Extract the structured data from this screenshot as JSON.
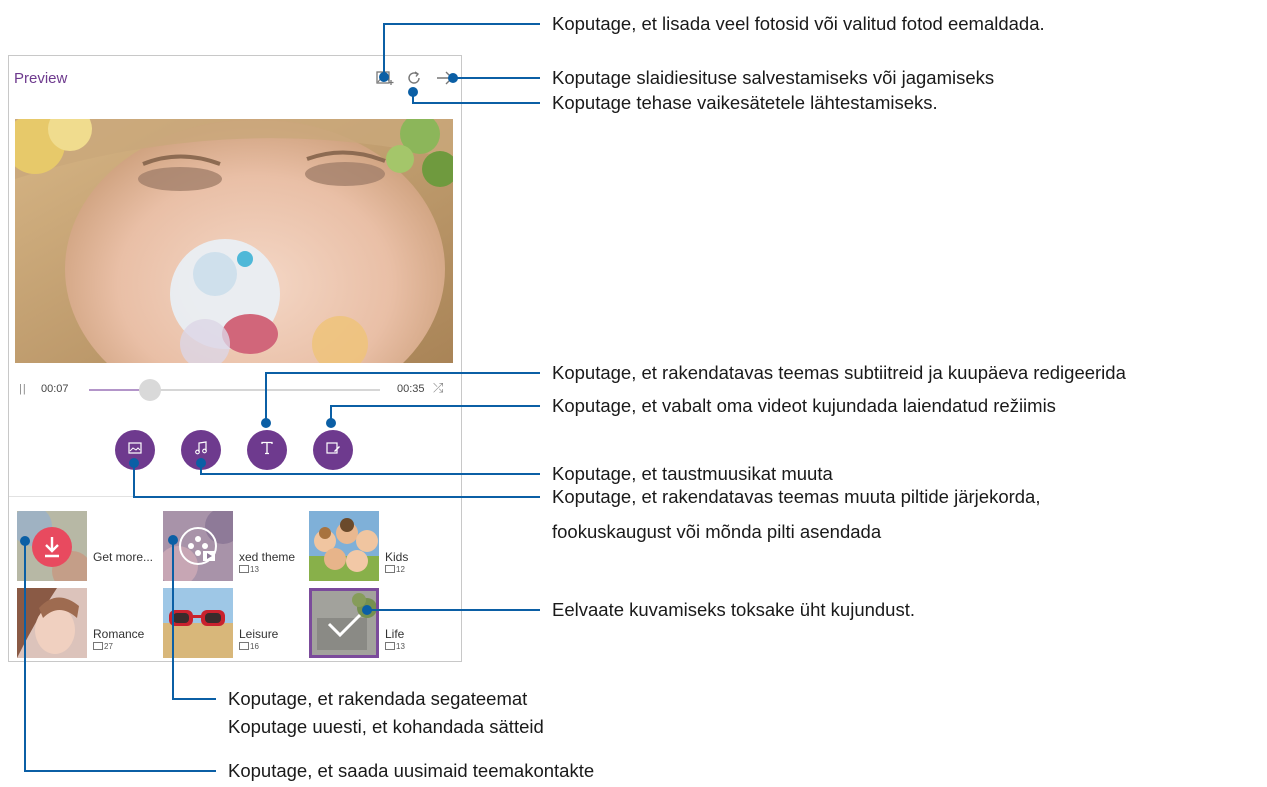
{
  "screen": {
    "title": "Preview",
    "icons": [
      "add-photo-icon",
      "reset-icon",
      "next-arrow-icon"
    ],
    "player": {
      "current_time": "00:07",
      "total_time": "00:35",
      "progress": 0.21
    },
    "tools": [
      "image-icon",
      "music-note-icon",
      "text-icon",
      "edit-video-icon"
    ],
    "themes": [
      {
        "name": "Get more...",
        "count": ""
      },
      {
        "name": "xed theme",
        "count": "13"
      },
      {
        "name": "Kids",
        "count": "12"
      },
      {
        "name": "Romance",
        "count": "27"
      },
      {
        "name": "Leisure",
        "count": "16"
      },
      {
        "name": "Life",
        "count": "13"
      }
    ]
  },
  "callouts": {
    "add_photos": "Koputage, et lisada veel fotosid või valitud fotod eemaldada.",
    "save_share": "Koputage slaidiesituse salvestamiseks või jagamiseks",
    "reset": "Koputage tehase vaikesätetele lähtestamiseks.",
    "subtitle": "Koputage, et rakendatavas teemas subtiitreid ja kuupäeva redigeerida",
    "advanced": "Koputage, et vabalt oma videot kujundada laiendatud režiimis",
    "music": "Koputage, et taustmuusikat muuta",
    "photos_line1": "Koputage, et rakendatavas teemas muuta piltide järjekorda,",
    "photos_line2": "fookuskaugust või mõnda pilti asendada",
    "preview_theme": "Eelvaate kuvamiseks toksake üht kujundust.",
    "mixed_line1": "Koputage, et rakendada segateemat",
    "mixed_line2": "Koputage uuesti, et kohandada sätteid",
    "get_more": "Koputage, et saada uusimaid teemakontakte"
  },
  "colors": {
    "accent": "#6e3a8e",
    "callout_line": "#0b5fa5",
    "download_badge": "#e84a5f"
  }
}
